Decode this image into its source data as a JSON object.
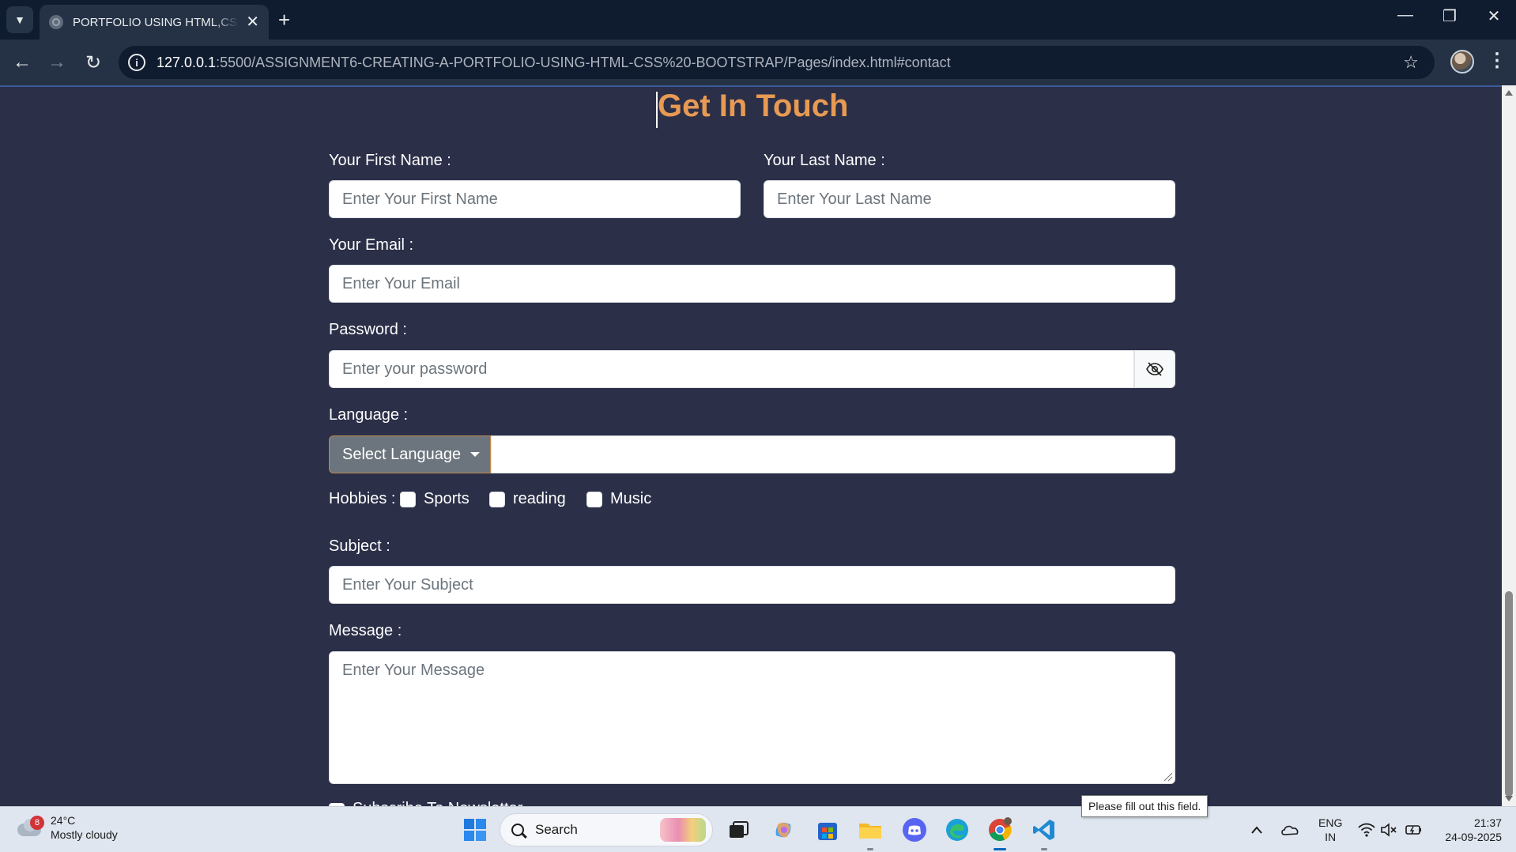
{
  "browser": {
    "tab_title": "PORTFOLIO USING HTML,CSS & BOOTSTRAP",
    "url_host": "127.0.0.1",
    "url_path": ":5500/ASSIGNMENT6-CREATING-A-PORTFOLIO-USING-HTML-CSS%20-BOOTSTRAP/Pages/index.html#contact"
  },
  "page": {
    "heading": "Get In Touch",
    "heading_color": "#e79a53",
    "background": "#2b2f48",
    "first_name": {
      "label": "Your First Name :",
      "placeholder": "Enter Your First Name"
    },
    "last_name": {
      "label": "Your Last Name :",
      "placeholder": "Enter Your Last Name"
    },
    "email": {
      "label": "Your Email :",
      "placeholder": "Enter Your Email"
    },
    "password": {
      "label": "Password :",
      "placeholder": "Enter your password",
      "toggle_icon": "eye-slash-icon"
    },
    "language": {
      "label": "Language :",
      "button_label": "Select Language"
    },
    "hobbies": {
      "label": "Hobbies :",
      "options": [
        {
          "label": "Sports",
          "checked": false
        },
        {
          "label": "reading",
          "checked": false
        },
        {
          "label": "Music",
          "checked": false
        }
      ]
    },
    "subject": {
      "label": "Subject :",
      "placeholder": "Enter Your Subject"
    },
    "message": {
      "label": "Message :",
      "placeholder": "Enter Your Message"
    },
    "newsletter_partial": "Subscribe To Newsletter",
    "validation_tooltip": "Please fill out this field."
  },
  "taskbar": {
    "weather": {
      "badge": "8",
      "temp": "24°C",
      "condition": "Mostly cloudy"
    },
    "search_placeholder": "Search",
    "language": {
      "line1": "ENG",
      "line2": "IN"
    },
    "time": "21:37",
    "date": "24-09-2025"
  }
}
